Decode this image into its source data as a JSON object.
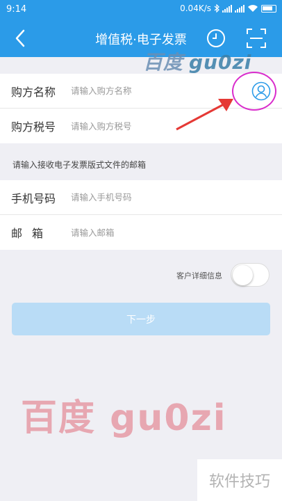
{
  "status_bar": {
    "time": "9:14",
    "network_speed": "0.04K/s",
    "icons": [
      "bluetooth-icon",
      "signal-icon",
      "signal-icon",
      "wifi-icon",
      "battery-icon"
    ]
  },
  "header": {
    "title": "增值税·电子发票",
    "back_icon": "chevron-left-icon",
    "history_icon": "clock-icon",
    "scan_icon": "scan-frame-icon",
    "background_color": "#2b9be8"
  },
  "watermarks": {
    "top_left": "百度",
    "top_right": "gu0zi",
    "bottom": "百度 gu0zi",
    "footer": "软件技巧"
  },
  "buyer_form": {
    "name": {
      "label": "购方名称",
      "placeholder": "请输入购方名称",
      "value": ""
    },
    "tax_id": {
      "label": "购方税号",
      "placeholder": "请输入购方税号",
      "value": ""
    },
    "contact_icon": "person-circle-icon",
    "highlight_color": "#d92ccc",
    "arrow_color": "#e53935"
  },
  "email_hint": "请输入接收电子发票版式文件的邮箱",
  "contact_form": {
    "phone": {
      "label": "手机号码",
      "placeholder": "请输入手机号码",
      "value": ""
    },
    "email": {
      "label": "邮箱",
      "placeholder": "请输入邮箱",
      "value": ""
    }
  },
  "detail_toggle": {
    "label": "客户详细信息",
    "on": false
  },
  "next_button": {
    "label": "下一步",
    "enabled": false,
    "color": "#b9dcf6"
  }
}
